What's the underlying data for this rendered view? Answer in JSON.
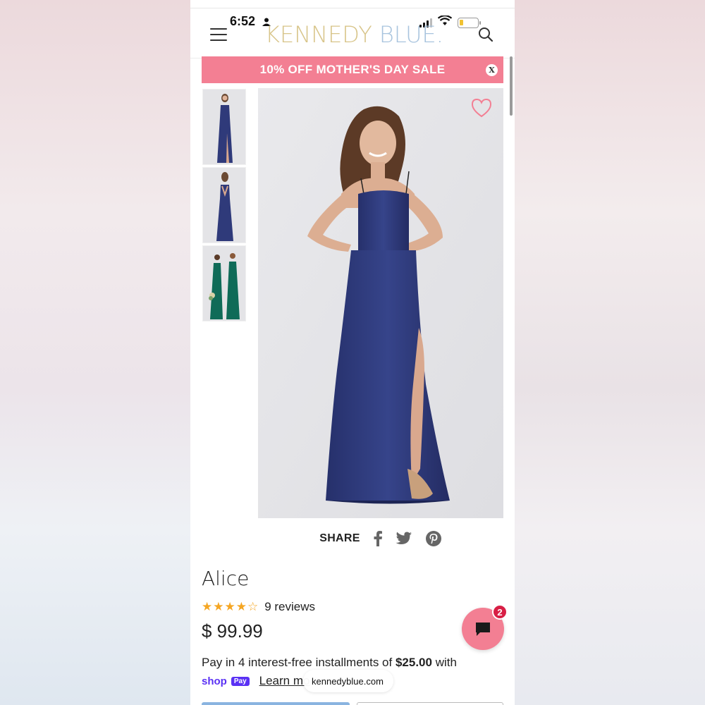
{
  "status_bar": {
    "time": "6:52"
  },
  "header": {
    "logo_word1": "KENNEDY",
    "logo_word2": "BLUE."
  },
  "banner": {
    "text": "10% OFF MOTHER'S DAY SALE",
    "close_label": "X"
  },
  "share": {
    "label": "SHARE"
  },
  "product": {
    "name": "Alice",
    "stars": "★★★★☆",
    "rating": 4,
    "reviews": "9 reviews",
    "price": "$ 99.99"
  },
  "payment": {
    "installments_prefix": "Pay in 4 interest-free installments of ",
    "installment_amount": "$25.00",
    "installments_suffix": " with",
    "shop_word": "shop",
    "pay_chip": "Pay",
    "learn_more": "Learn mo"
  },
  "chat": {
    "badge_count": "2"
  },
  "browser": {
    "url": "kennedyblue.com"
  },
  "colors": {
    "accent_pink": "#f37f93",
    "badge_red": "#d81f45",
    "dress_navy": "#2f3a7a",
    "dress_green": "#0f6b58",
    "shop_purple": "#5a31f4",
    "star_gold": "#f5a623"
  }
}
